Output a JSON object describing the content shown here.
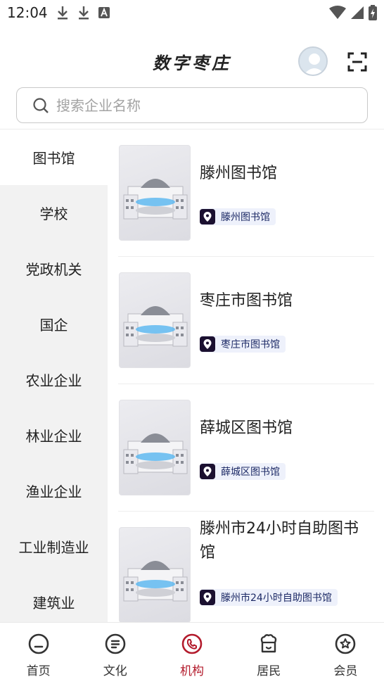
{
  "status_bar": {
    "time": "12:04",
    "left_icons": [
      "download-icon",
      "download-icon",
      "text-a-icon"
    ],
    "right_icons": [
      "wifi-icon",
      "signal-icon",
      "battery-charging-icon"
    ]
  },
  "header": {
    "title": "数字枣庄",
    "avatar_icon": "user-avatar-icon",
    "scan_icon": "scan-icon"
  },
  "search": {
    "placeholder": "搜索企业名称",
    "icon": "search-icon"
  },
  "sidebar": {
    "items": [
      {
        "label": "图书馆",
        "active": true
      },
      {
        "label": "学校",
        "active": false
      },
      {
        "label": "党政机关",
        "active": false
      },
      {
        "label": "国企",
        "active": false
      },
      {
        "label": "农业企业",
        "active": false
      },
      {
        "label": "林业企业",
        "active": false
      },
      {
        "label": "渔业企业",
        "active": false
      },
      {
        "label": "工业制造业",
        "active": false
      },
      {
        "label": "建筑业",
        "active": false
      }
    ]
  },
  "list": {
    "items": [
      {
        "title": "滕州图书馆",
        "tag": "滕州图书馆"
      },
      {
        "title": "枣庄市图书馆",
        "tag": "枣庄市图书馆"
      },
      {
        "title": "薛城区图书馆",
        "tag": "薛城区图书馆"
      },
      {
        "title": "滕州市24小时自助图书馆",
        "tag": "滕州市24小时自助图书馆"
      }
    ]
  },
  "bottom_nav": {
    "items": [
      {
        "label": "首页",
        "icon": "home-face-icon",
        "active": false
      },
      {
        "label": "文化",
        "icon": "book-icon",
        "active": false
      },
      {
        "label": "机构",
        "icon": "phone-icon",
        "active": true
      },
      {
        "label": "居民",
        "icon": "resident-icon",
        "active": false
      },
      {
        "label": "会员",
        "icon": "member-star-icon",
        "active": false
      }
    ],
    "active_color": "#b31b2c"
  },
  "colors": {
    "accent": "#b31b2c",
    "sidebar_bg": "#f2f2f2",
    "tag_bg": "#eef1fb",
    "tag_text": "#1d2a66"
  }
}
